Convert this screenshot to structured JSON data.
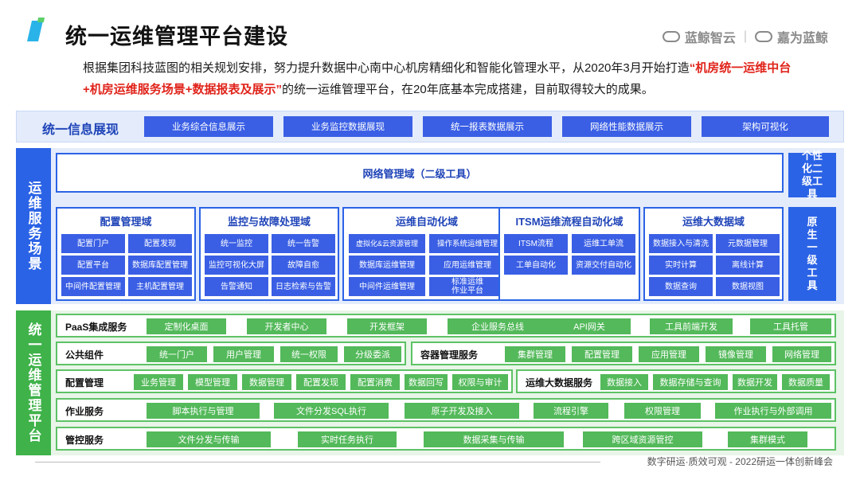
{
  "header": {
    "title": "统一运维管理平台建设",
    "brand1": "蓝鲸智云",
    "brand_sep": "|",
    "brand2": "嘉为蓝鲸"
  },
  "intro": {
    "p1": "根据集团科技蓝图的相关规划安排，努力提升数据中心南中心机房精细化和智能化管理水平，从2020年3月开始打造",
    "highlight": "“机房统一运维中台+机房运维服务场景+数据报表及展示”",
    "p2": "的统一运维管理平台，在20年底基本完成搭建，目前取得较大的成果。"
  },
  "info_row": {
    "title": "统一信息展现",
    "items": [
      "业务综合信息展示",
      "业务监控数据展现",
      "统一报表数据展示",
      "网络性能数据展示",
      "架构可视化"
    ]
  },
  "scenario": {
    "side_label": "运维服务场景",
    "network_domain": "网络管理域（二级工具）",
    "personal_tools": "个性化二级工具",
    "native_tools": "原生一级工具",
    "domains": [
      {
        "title": "配置管理域",
        "items": [
          "配置门户",
          "配置发现",
          "配置平台",
          "数据库配置管理",
          "中间件配置管理",
          "主机配置管理"
        ]
      },
      {
        "title": "监控与故障处理域",
        "items": [
          "统一监控",
          "统一告警",
          "监控可视化大屏",
          "故障自愈",
          "告警通知",
          "日志检索与告警"
        ]
      },
      {
        "title": "运维自动化域",
        "items": [
          "虚拟化&云资源管理",
          "操作系统运维管理",
          "数据库运维管理",
          "应用运维管理",
          "中间件运维管理",
          "标准运维作业平台"
        ]
      },
      {
        "title": "ITSM运维流程自动化域",
        "items": [
          "ITSM流程",
          "运维工单流",
          "工单自动化",
          "资源交付自动化"
        ]
      },
      {
        "title": "运维大数据域",
        "items": [
          "数据接入与清洗",
          "元数据管理",
          "实时计算",
          "离线计算",
          "数据查询",
          "数据视图"
        ]
      }
    ]
  },
  "platform": {
    "side_label": "统一运维管理平台",
    "paas": {
      "label": "PaaS集成服务",
      "items": [
        "定制化桌面",
        "开发者中心",
        "开发框架",
        "企业服务总线",
        "API网关",
        "工具前端开发",
        "工具托管"
      ]
    },
    "common": {
      "label": "公共组件",
      "items": [
        "统一门户",
        "用户管理",
        "统一权限",
        "分级委派"
      ]
    },
    "container": {
      "label": "容器管理服务",
      "items": [
        "集群管理",
        "配置管理",
        "应用管理",
        "镜像管理",
        "网络管理"
      ]
    },
    "config": {
      "label": "配置管理",
      "items": [
        "业务管理",
        "模型管理",
        "数据管理",
        "配置发现",
        "配置消费",
        "数据回写",
        "权限与审计"
      ]
    },
    "bigdata": {
      "label": "运维大数据服务",
      "items": [
        "数据接入",
        "数据存储与查询",
        "数据开发",
        "数据质量"
      ]
    },
    "job": {
      "label": "作业服务",
      "items": [
        "脚本执行与管理",
        "文件分发SQL执行",
        "原子开发及接入",
        "流程引擎",
        "权限管理",
        "作业执行与外部调用"
      ]
    },
    "control": {
      "label": "管控服务",
      "items": [
        "文件分发与传输",
        "实时任务执行",
        "数据采集与传输",
        "跨区域资源管控",
        "集群模式"
      ]
    }
  },
  "footer": {
    "text": "数字研运·质效可观  -  2022研运一体创新峰会"
  },
  "colors": {
    "blue": "#2b63e6",
    "btn_blue": "#3a5fe5",
    "green": "#3fb24a",
    "btn_green": "#53b95a",
    "red": "#e0241b"
  }
}
